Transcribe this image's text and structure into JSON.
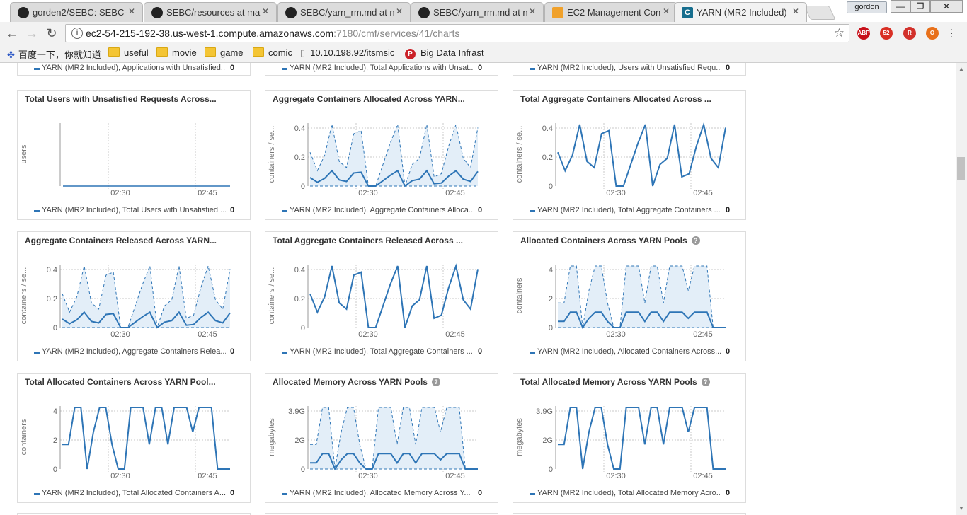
{
  "browser": {
    "tabs": [
      {
        "label": "gorden2/SEBC: SEBC-",
        "icon": "github-icon"
      },
      {
        "label": "SEBC/resources at ma",
        "icon": "github-icon"
      },
      {
        "label": "SEBC/yarn_rm.md at n",
        "icon": "github-icon"
      },
      {
        "label": "SEBC/yarn_rm.md at n",
        "icon": "github-icon"
      },
      {
        "label": "EC2 Management Con",
        "icon": "aws-icon"
      },
      {
        "label": "YARN (MR2 Included)",
        "icon": "cloudera-icon",
        "active": true
      }
    ],
    "profile_name": "gordon",
    "window_buttons": {
      "minimize": "—",
      "restore": "❐",
      "close": "✕"
    },
    "url_host": "ec2-54-215-192-38.us-west-1.compute.amazonaws.com",
    "url_path": ":7180/cmf/services/41/charts",
    "extensions": [
      {
        "name": "ABP",
        "color": "#c7101a"
      },
      {
        "name": "52",
        "color": "#d93025"
      },
      {
        "name": "R",
        "color": "#d2312b"
      },
      {
        "name": "O",
        "color": "#e8701a"
      }
    ],
    "bookmarks": [
      {
        "label": "百度一下，你就知道",
        "type": "baidu"
      },
      {
        "label": "useful",
        "type": "folder"
      },
      {
        "label": "movie",
        "type": "folder"
      },
      {
        "label": "game",
        "type": "folder"
      },
      {
        "label": "comic",
        "type": "folder"
      },
      {
        "label": "10.10.198.92/itsmsic",
        "type": "page"
      },
      {
        "label": "Big Data Infrastructu",
        "type": "pinterest"
      }
    ]
  },
  "top_legends": [
    {
      "text": "YARN (MR2 Included), Applications with Unsatisfied...",
      "value": "0"
    },
    {
      "text": "YARN (MR2 Included), Total Applications with Unsat...",
      "value": "0"
    },
    {
      "text": "YARN (MR2 Included), Users with Unsatisfied Requ...",
      "value": "0"
    }
  ],
  "x_tick_labels": [
    "02:30",
    "02:45"
  ],
  "charts": [
    {
      "title": "Total Users with Unsatisfied Requests Across...",
      "ylabel": "users",
      "help": false,
      "yticks": [],
      "style": "flat",
      "legend": "YARN (MR2 Included), Total Users with Unsatisfied ...",
      "value": "0"
    },
    {
      "title": "Aggregate Containers Allocated Across YARN...",
      "ylabel": "containers / se...",
      "help": false,
      "yticks": [
        "0.4",
        "0.2",
        "0"
      ],
      "style": "band",
      "legend": "YARN (MR2 Included), Aggregate Containers Alloca...",
      "value": "0"
    },
    {
      "title": "Total Aggregate Containers Allocated Across ...",
      "ylabel": "containers / se...",
      "help": false,
      "yticks": [
        "0.4",
        "0.2",
        "0"
      ],
      "style": "line",
      "legend": "YARN (MR2 Included), Total Aggregate Containers ...",
      "value": "0"
    },
    {
      "title": "Aggregate Containers Released Across YARN...",
      "ylabel": "containers / se...",
      "help": false,
      "yticks": [
        "0.4",
        "0.2",
        "0"
      ],
      "style": "band",
      "legend": "YARN (MR2 Included), Aggregate Containers Relea...",
      "value": "0"
    },
    {
      "title": "Total Aggregate Containers Released Across ...",
      "ylabel": "containers / se...",
      "help": false,
      "yticks": [
        "0.4",
        "0.2",
        "0"
      ],
      "style": "line",
      "legend": "YARN (MR2 Included), Total Aggregate Containers ...",
      "value": "0"
    },
    {
      "title": "Allocated Containers Across YARN Pools",
      "ylabel": "containers",
      "help": true,
      "yticks": [
        "4",
        "2",
        "0"
      ],
      "style": "band_step",
      "legend": "YARN (MR2 Included), Allocated Containers Across...",
      "value": "0"
    },
    {
      "title": "Total Allocated Containers Across YARN Pool...",
      "ylabel": "containers",
      "help": false,
      "yticks": [
        "4",
        "2",
        "0"
      ],
      "style": "step",
      "legend": "YARN (MR2 Included), Total Allocated Containers A...",
      "value": "0"
    },
    {
      "title": "Allocated Memory Across YARN Pools",
      "ylabel": "megabytes",
      "help": true,
      "yticks": [
        "3.9G",
        "2G",
        "0"
      ],
      "style": "band_step",
      "legend": "YARN (MR2 Included), Allocated Memory Across Y...",
      "value": "0"
    },
    {
      "title": "Total Allocated Memory Across YARN Pools",
      "ylabel": "megabytes",
      "help": true,
      "yticks": [
        "3.9G",
        "2G",
        "0"
      ],
      "style": "step",
      "legend": "YARN (MR2 Included), Total Allocated Memory Acro...",
      "value": "0"
    }
  ],
  "colors": {
    "series": "#2e75b6",
    "band": "#e3eef8",
    "grid": "#c8c8c8"
  }
}
